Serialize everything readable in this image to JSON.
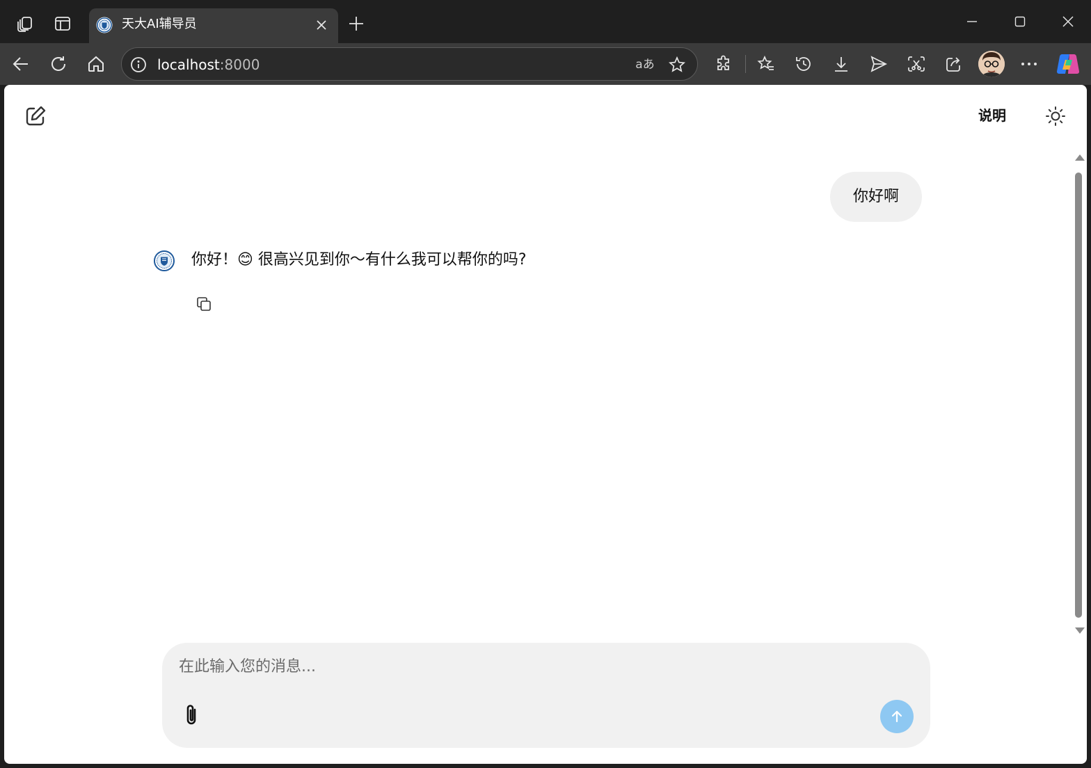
{
  "browser": {
    "tab": {
      "title": "天大AI辅导员"
    },
    "address_bar": {
      "host": "localhost",
      "port": ":8000",
      "read_aloud_label": "aあ"
    }
  },
  "page": {
    "help_label": "说明",
    "messages": [
      {
        "role": "user",
        "text": "你好啊"
      },
      {
        "role": "assistant",
        "text": "你好！😊 很高兴见到你～有什么我可以帮你的吗?"
      }
    ],
    "composer": {
      "placeholder": "在此输入您的消息...",
      "value": ""
    }
  },
  "colors": {
    "browser_frame": "#1f1f1f",
    "toolbar": "#3b3b3b",
    "user_bubble": "#f0f0f0",
    "composer_bg": "#f1f1f1",
    "send_button": "#8ec8f2"
  }
}
